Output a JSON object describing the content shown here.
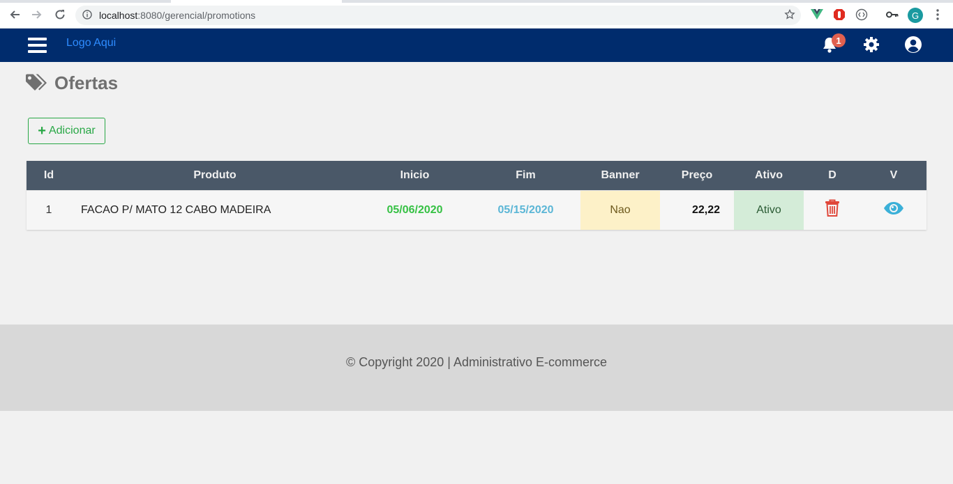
{
  "browser": {
    "url_host": "localhost",
    "url_rest": ":8080/gerencial/promotions",
    "avatar_letter": "G"
  },
  "navbar": {
    "logo_text": "Logo Aqui",
    "notification_count": "1",
    "bg_color": "#002c6d"
  },
  "page": {
    "title": "Ofertas",
    "add_button_label": "Adicionar"
  },
  "table": {
    "headers": [
      "Id",
      "Produto",
      "Inicio",
      "Fim",
      "Banner",
      "Preço",
      "Ativo",
      "D",
      "V"
    ],
    "rows": [
      {
        "id": "1",
        "produto": "FACAO P/ MATO 12 CABO MADEIRA",
        "inicio": "05/06/2020",
        "fim": "05/15/2020",
        "banner": "Nao",
        "preco": "22,22",
        "ativo": "Ativo"
      }
    ]
  },
  "footer": {
    "text": "© Copyright 2020 | Administrativo E-commerce"
  }
}
